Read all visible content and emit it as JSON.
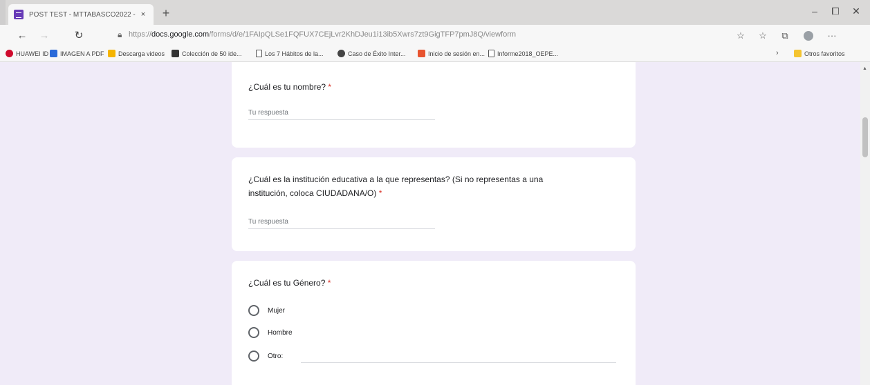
{
  "browser": {
    "tab": {
      "title": "POST TEST - MTTABASCO2022 -",
      "close_icon": "×"
    },
    "new_tab_icon": "+",
    "window_controls": {
      "minimize": "–",
      "maximize": "⧠",
      "close": "✕"
    },
    "address": {
      "prefix": "https://",
      "host": "docs.google.com",
      "path": "/forms/d/e/1FAIpQLSe1FQFUX7CEjLvr2KhDJeu1i13ib5Xwrs7zt9GigTFP7pmJ8Q/viewform"
    },
    "bookmarks": [
      {
        "label": "HUAWEI ID",
        "color": "#cf0a2c"
      },
      {
        "label": "IMAGEN A PDF",
        "color": "#2a6ad9"
      },
      {
        "label": "Descarga videos",
        "color": "#f5b400"
      },
      {
        "label": "Colección de 50 ide...",
        "color": "#333333"
      },
      {
        "label": "Los 7 Hábitos de la...",
        "color": "#ffffff"
      },
      {
        "label": "Caso de Éxito Inter...",
        "color": "#444444"
      },
      {
        "label": "Inicio de sesión en...",
        "color": "#e8542f"
      },
      {
        "label": "Informe2018_OEPE...",
        "color": "#ffffff"
      }
    ],
    "bookmarks_overflow": "›",
    "other_favorites": "Otros favoritos"
  },
  "form": {
    "questions": [
      {
        "text": "¿Cuál es tu nombre?",
        "required_mark": "*",
        "placeholder": "Tu respuesta"
      },
      {
        "text_line1": "¿Cuál es la institución educativa a la que representas? (Si no representas a una",
        "text_line2": "institución, coloca CIUDADANA/O)",
        "required_mark": "*",
        "placeholder": "Tu respuesta"
      },
      {
        "text": "¿Cuál es tu Género?",
        "required_mark": "*",
        "options": [
          "Mujer",
          "Hombre",
          "Otro:"
        ]
      }
    ]
  },
  "colors": {
    "page_background": "#f0ebf8",
    "accent": "#673ab7",
    "required": "#d93025"
  }
}
